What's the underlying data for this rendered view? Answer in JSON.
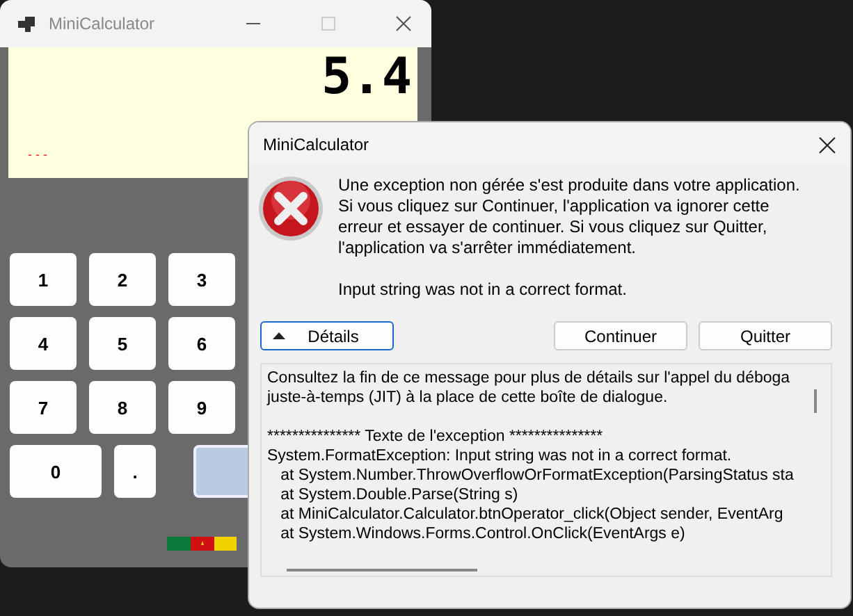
{
  "calculator": {
    "title": "MiniCalculator",
    "maximize_disabled": true,
    "display": "5.4",
    "indicator": "- - -",
    "keys": [
      {
        "label": "1",
        "kind": "digit",
        "highlighted": false
      },
      {
        "label": "2",
        "kind": "digit",
        "highlighted": false
      },
      {
        "label": "3",
        "kind": "digit",
        "highlighted": false
      },
      {
        "label": "4",
        "kind": "digit",
        "highlighted": false
      },
      {
        "label": "5",
        "kind": "digit",
        "highlighted": false
      },
      {
        "label": "6",
        "kind": "digit",
        "highlighted": false
      },
      {
        "label": "7",
        "kind": "digit",
        "highlighted": false
      },
      {
        "label": "8",
        "kind": "digit",
        "highlighted": false
      },
      {
        "label": "9",
        "kind": "digit",
        "highlighted": false
      },
      {
        "label": "0",
        "kind": "wide",
        "highlighted": false
      },
      {
        "label": ".",
        "kind": "digit",
        "highlighted": false
      },
      {
        "kind": "operator",
        "highlighted": true
      }
    ]
  },
  "dialog": {
    "title": "MiniCalculator",
    "message": [
      "Une exception non gérée s'est produite dans votre application.",
      "Si vous cliquez sur Continuer, l'application va ignorer cette",
      "erreur et essayer de continuer. Si vous cliquez sur Quitter,",
      "l'application va s'arrêter immédiatement."
    ],
    "error": "Input string was not in a correct format.",
    "buttons": [
      {
        "label": "Détails",
        "kind": "toggle",
        "focused": true
      },
      {
        "label": "Continuer",
        "kind": "plain",
        "focused": false
      },
      {
        "label": "Quitter",
        "kind": "plain",
        "focused": false
      }
    ],
    "details": [
      [
        "Consultez la fin de ce message pour plus de détails sur l'appel du déboga",
        "juste-à-temps (JIT) à la place de cette boîte de dialogue."
      ],
      [
        "*************** Texte de l'exception ***************",
        "System.FormatException: Input string was not in a correct format.",
        "   at System.Number.ThrowOverflowOrFormatException(ParsingStatus sta",
        "   at System.Double.Parse(String s)",
        "   at MiniCalculator.Calculator.btnOperator_click(Object sender, EventArg",
        "   at System.Windows.Forms.Control.OnClick(EventArgs e)"
      ]
    ]
  }
}
